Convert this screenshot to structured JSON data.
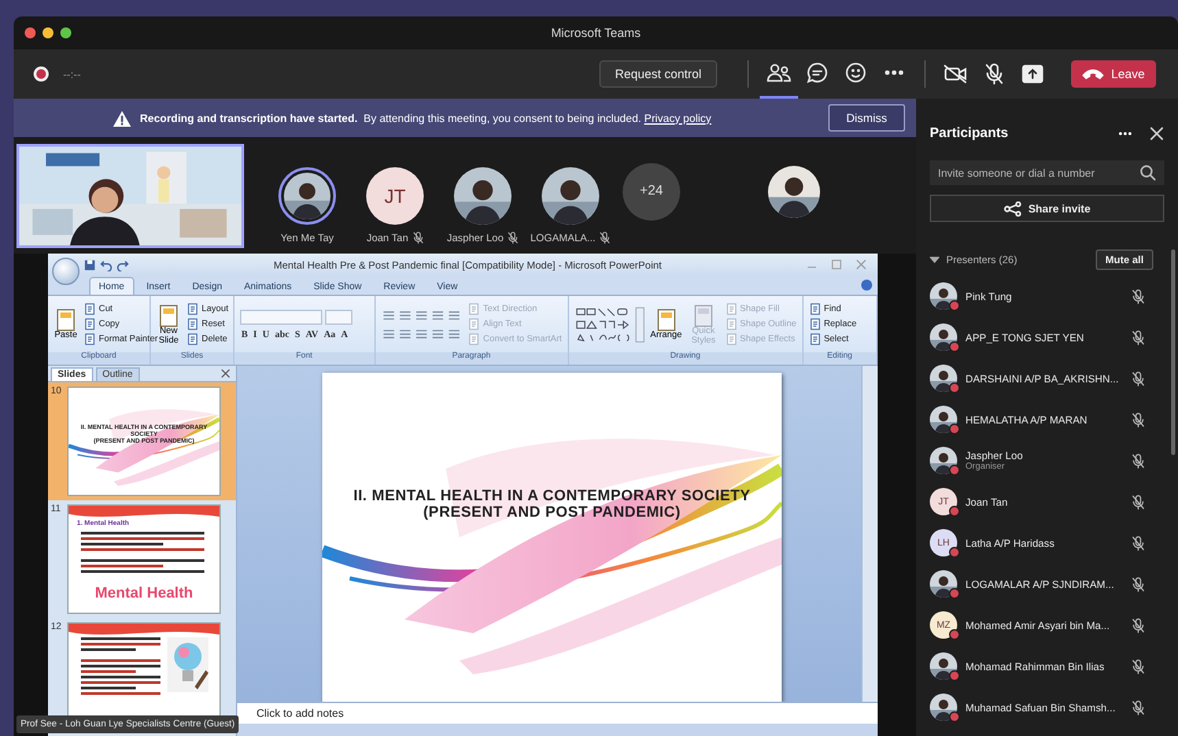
{
  "window": {
    "title": "Microsoft Teams"
  },
  "toolbar": {
    "timer": "--:--",
    "request_control": "Request control",
    "leave": "Leave",
    "tabs": [
      {
        "kind": "people",
        "selected": true
      },
      {
        "kind": "chat",
        "selected": false
      },
      {
        "kind": "reactions",
        "selected": false
      },
      {
        "kind": "more",
        "selected": false
      }
    ]
  },
  "banner": {
    "bold": "Recording and transcription have started.",
    "text": "By attending this meeting, you consent to being included.",
    "link": "Privacy policy",
    "button": "Dismiss"
  },
  "video_strip": {
    "overflow": "+24",
    "tiles": [
      {
        "name": "Yen Me Tay",
        "speaking": true,
        "muted": false
      },
      {
        "name": "Joan Tan",
        "avatar": {
          "kind": "initials",
          "initials": "JT",
          "color": "#f2dcdc"
        },
        "speaking": false,
        "muted": true
      },
      {
        "name": "Jaspher Loo",
        "speaking": false,
        "muted": true
      },
      {
        "name": "LOGAMALA...",
        "speaking": false,
        "muted": true
      }
    ]
  },
  "presentation": {
    "presenter_label": "Prof See - Loh Guan Lye Specialists Centre (Guest)",
    "app": {
      "title": "Mental Health Pre & Post Pandemic  final [Compatibility Mode] - Microsoft PowerPoint",
      "tabs": [
        {
          "label": "Home",
          "selected": true
        },
        {
          "label": "Insert",
          "selected": false
        },
        {
          "label": "Design",
          "selected": false
        },
        {
          "label": "Animations",
          "selected": false
        },
        {
          "label": "Slide Show",
          "selected": false
        },
        {
          "label": "Review",
          "selected": false
        },
        {
          "label": "View",
          "selected": false
        }
      ],
      "ribbon": [
        {
          "label": "Clipboard",
          "kind": "standard",
          "large": [
            {
              "label": "Paste",
              "disabled": false
            }
          ],
          "small": [
            {
              "label": "Cut",
              "disabled": false
            },
            {
              "label": "Copy",
              "disabled": false
            },
            {
              "label": "Format Painter",
              "disabled": false
            }
          ]
        },
        {
          "label": "Slides",
          "kind": "standard",
          "large": [
            {
              "label": "New Slide",
              "disabled": false
            }
          ],
          "small": [
            {
              "label": "Layout",
              "disabled": false
            },
            {
              "label": "Reset",
              "disabled": false
            },
            {
              "label": "Delete",
              "disabled": false
            }
          ]
        },
        {
          "label": "Font",
          "kind": "font",
          "buttons": [
            "B",
            "I",
            "U",
            "abc",
            "S",
            "AV",
            "Aa",
            "A"
          ]
        },
        {
          "label": "Paragraph",
          "kind": "paragraph",
          "small": [
            {
              "label": "Text Direction",
              "disabled": true
            },
            {
              "label": "Align Text",
              "disabled": true
            },
            {
              "label": "Convert to SmartArt",
              "disabled": true
            }
          ]
        },
        {
          "label": "Drawing",
          "kind": "drawing",
          "large": [
            {
              "label": "Arrange",
              "disabled": false
            },
            {
              "label": "Quick Styles",
              "disabled": true
            }
          ],
          "small": [
            {
              "label": "Shape Fill",
              "disabled": true
            },
            {
              "label": "Shape Outline",
              "disabled": true
            },
            {
              "label": "Shape Effects",
              "disabled": true
            }
          ]
        },
        {
          "label": "Editing",
          "kind": "standard",
          "small": [
            {
              "label": "Find",
              "disabled": false
            },
            {
              "label": "Replace",
              "disabled": false
            },
            {
              "label": "Select",
              "disabled": false
            }
          ]
        }
      ],
      "pane_tabs": [
        {
          "label": "Slides",
          "selected": true
        },
        {
          "label": "Outline",
          "selected": false
        }
      ],
      "thumbnails": [
        {
          "number": "10",
          "selected": true,
          "kind": "title",
          "lines": [
            "II. MENTAL HEALTH IN A CONTEMPORARY  SOCIETY",
            "(PRESENT AND POST PANDEMIC)"
          ]
        },
        {
          "number": "11",
          "selected": false,
          "kind": "content",
          "heading": "1. Mental Health",
          "art_text": "Mental Health"
        },
        {
          "number": "12",
          "selected": false,
          "kind": "content_image"
        }
      ],
      "slide": {
        "lines": [
          "II. MENTAL HEALTH IN A CONTEMPORARY SOCIETY",
          "(PRESENT AND POST PANDEMIC)"
        ]
      },
      "notes_placeholder": "Click to add notes"
    }
  },
  "panel": {
    "title": "Participants",
    "search_placeholder": "Invite someone or dial a number",
    "share_button": "Share invite",
    "section": {
      "label": "Presenters (26)",
      "expanded": true,
      "button": "Mute all"
    },
    "participants": [
      {
        "name": "Pink Tung",
        "busy": true,
        "muted": true
      },
      {
        "name": "APP_E TONG SJET YEN",
        "busy": true,
        "muted": true
      },
      {
        "name": "DARSHAINI A/P BA_AKRISHN...",
        "busy": true,
        "muted": true
      },
      {
        "name": "HEMALATHA A/P MARAN",
        "busy": true,
        "muted": true
      },
      {
        "name": "Jaspher Loo",
        "role": "Organiser",
        "busy": true,
        "muted": true
      },
      {
        "name": "Joan Tan",
        "avatar": {
          "kind": "initials",
          "initials": "JT",
          "color": "#f2dcdc"
        },
        "busy": true,
        "muted": true
      },
      {
        "name": "Latha A/P Haridass",
        "avatar": {
          "kind": "initials",
          "initials": "LH",
          "color": "#dcdcf4"
        },
        "busy": true,
        "muted": true
      },
      {
        "name": "LOGAMALAR A/P SJNDIRAM...",
        "busy": true,
        "muted": true
      },
      {
        "name": "Mohamed Amir Asyari bin Ma...",
        "avatar": {
          "kind": "initials",
          "initials": "MZ",
          "color": "#f6ead0"
        },
        "busy": true,
        "muted": true
      },
      {
        "name": "Mohamad Rahimman Bin Ilias",
        "busy": true,
        "muted": true
      },
      {
        "name": "Muhamad Safuan Bin Shamsh...",
        "busy": true,
        "muted": true
      }
    ]
  }
}
